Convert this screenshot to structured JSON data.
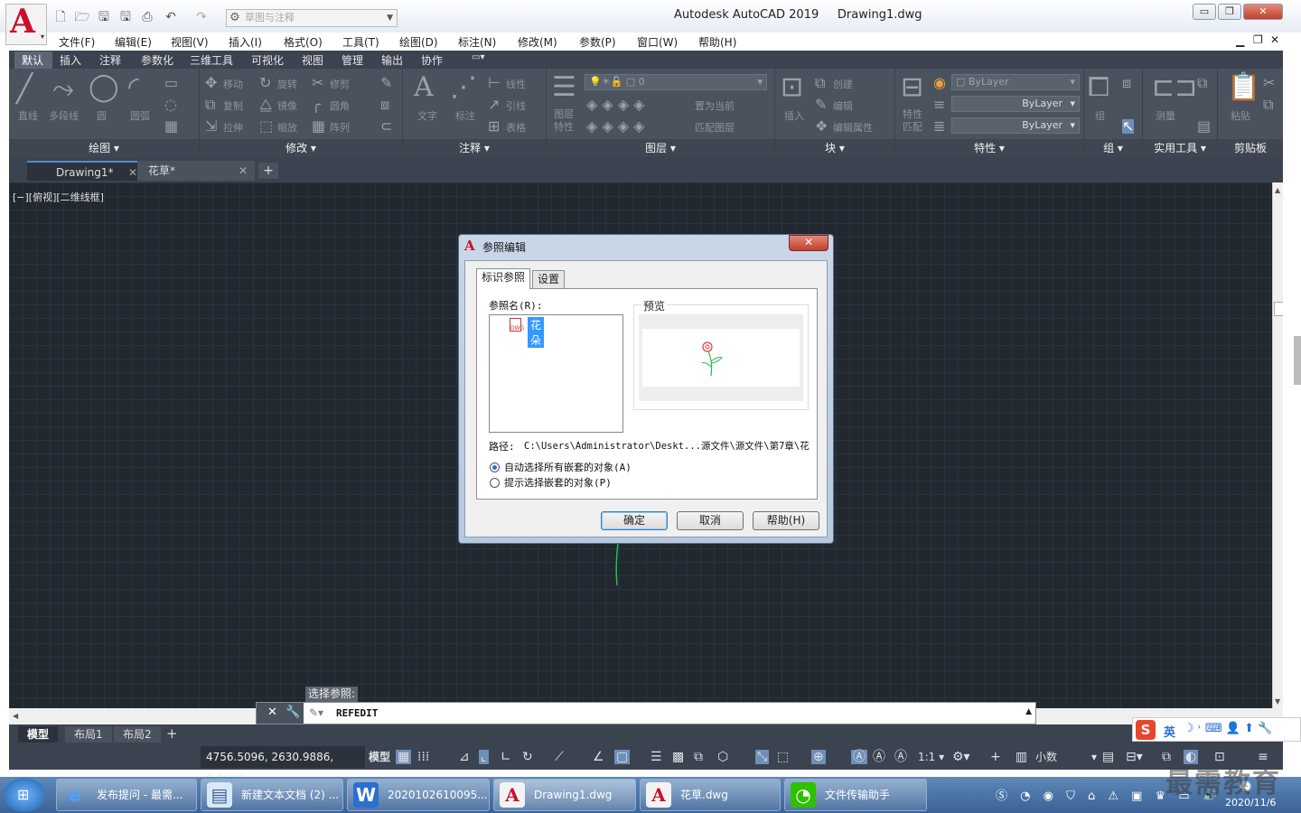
{
  "app": {
    "title": "Autodesk AutoCAD 2019",
    "document": "Drawing1.dwg",
    "workspace": "草图与注释"
  },
  "menu": [
    "文件(F)",
    "编辑(E)",
    "视图(V)",
    "插入(I)",
    "格式(O)",
    "工具(T)",
    "绘图(D)",
    "标注(N)",
    "修改(M)",
    "参数(P)",
    "窗口(W)",
    "帮助(H)"
  ],
  "ribbon_tabs": [
    "默认",
    "插入",
    "注释",
    "参数化",
    "三维工具",
    "可视化",
    "视图",
    "管理",
    "输出",
    "协作"
  ],
  "ribbon": {
    "draw": {
      "label": "绘图",
      "line": "直线",
      "polyline": "多段线",
      "circle": "圆",
      "arc": "圆弧"
    },
    "modify": {
      "label": "修改",
      "move": "移动",
      "rotate": "旋转",
      "trim": "修剪",
      "copy": "复制",
      "mirror": "镜像",
      "fillet": "圆角",
      "stretch": "拉伸",
      "scale": "缩放",
      "array": "阵列"
    },
    "annotation": {
      "label": "注释",
      "text": "文字",
      "dimension": "标注",
      "linear": "线性",
      "leader": "引线",
      "table": "表格"
    },
    "layers": {
      "label": "图层",
      "layer_props": "图层\n特性",
      "current_layer": "0",
      "make_current": "置为当前",
      "match_layer": "匹配图层"
    },
    "block": {
      "label": "块",
      "insert": "插入",
      "create": "创建",
      "edit": "编辑",
      "edit_attr": "编辑属性"
    },
    "properties": {
      "label": "特性",
      "match": "特性\n匹配",
      "color": "ByLayer",
      "linetype": "ByLayer",
      "lineweight": "ByLayer"
    },
    "groups": {
      "label": "组",
      "group": "组"
    },
    "utilities": {
      "label": "实用工具",
      "measure": "测量"
    },
    "clipboard": {
      "label": "剪贴板",
      "paste": "粘贴"
    }
  },
  "doc_tabs": [
    "Drawing1*",
    "花草*"
  ],
  "viewport_label": "[−][俯视][二维线框]",
  "dialog": {
    "title": "参照编辑",
    "tabs": [
      "标识参照",
      "设置"
    ],
    "ref_name_label": "参照名(R):",
    "ref_item": "花朵",
    "preview_label": "预览",
    "path_label": "路径:",
    "path_value": "C:\\Users\\Administrator\\Deskt...源文件\\源文件\\第7章\\花",
    "radio_auto": "自动选择所有嵌套的对象(A)",
    "radio_prompt": "提示选择嵌套的对象(P)",
    "ok": "确定",
    "cancel": "取消",
    "help": "帮助(H)"
  },
  "command": {
    "prompt": "选择参照:",
    "current": "REFEDIT"
  },
  "layout_tabs": [
    "模型",
    "布局1",
    "布局2"
  ],
  "status": {
    "coords": "4756.5096, 2630.9886, 0.0000",
    "model": "模型",
    "scale": "1:1",
    "units": "小数"
  },
  "taskbar": {
    "items": [
      "发布提问 - 最需...",
      "新建文本文档 (2) ...",
      "2020102610095...",
      "Drawing1.dwg",
      "花草.dwg",
      "文件传输助手"
    ],
    "ime": "英",
    "date": "2020/11/6",
    "watermark": "最需教育"
  },
  "colors": {
    "accent": "#c8102e",
    "canvas": "#212830",
    "ribbon": "#4a525e",
    "selection": "#3399ff"
  }
}
